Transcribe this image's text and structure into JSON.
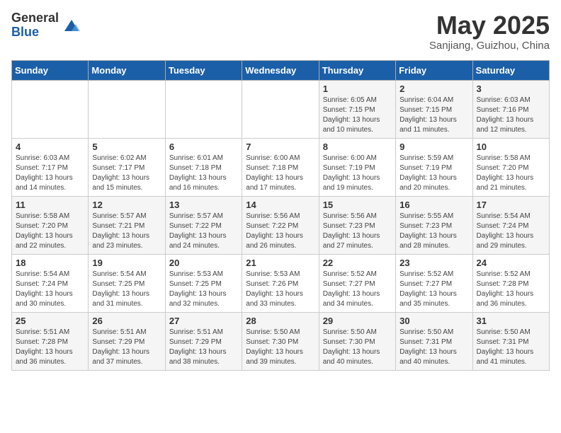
{
  "logo": {
    "general": "General",
    "blue": "Blue"
  },
  "title": "May 2025",
  "location": "Sanjiang, Guizhou, China",
  "days_of_week": [
    "Sunday",
    "Monday",
    "Tuesday",
    "Wednesday",
    "Thursday",
    "Friday",
    "Saturday"
  ],
  "weeks": [
    [
      {
        "day": "",
        "info": ""
      },
      {
        "day": "",
        "info": ""
      },
      {
        "day": "",
        "info": ""
      },
      {
        "day": "",
        "info": ""
      },
      {
        "day": "1",
        "info": "Sunrise: 6:05 AM\nSunset: 7:15 PM\nDaylight: 13 hours\nand 10 minutes."
      },
      {
        "day": "2",
        "info": "Sunrise: 6:04 AM\nSunset: 7:15 PM\nDaylight: 13 hours\nand 11 minutes."
      },
      {
        "day": "3",
        "info": "Sunrise: 6:03 AM\nSunset: 7:16 PM\nDaylight: 13 hours\nand 12 minutes."
      }
    ],
    [
      {
        "day": "4",
        "info": "Sunrise: 6:03 AM\nSunset: 7:17 PM\nDaylight: 13 hours\nand 14 minutes."
      },
      {
        "day": "5",
        "info": "Sunrise: 6:02 AM\nSunset: 7:17 PM\nDaylight: 13 hours\nand 15 minutes."
      },
      {
        "day": "6",
        "info": "Sunrise: 6:01 AM\nSunset: 7:18 PM\nDaylight: 13 hours\nand 16 minutes."
      },
      {
        "day": "7",
        "info": "Sunrise: 6:00 AM\nSunset: 7:18 PM\nDaylight: 13 hours\nand 17 minutes."
      },
      {
        "day": "8",
        "info": "Sunrise: 6:00 AM\nSunset: 7:19 PM\nDaylight: 13 hours\nand 19 minutes."
      },
      {
        "day": "9",
        "info": "Sunrise: 5:59 AM\nSunset: 7:19 PM\nDaylight: 13 hours\nand 20 minutes."
      },
      {
        "day": "10",
        "info": "Sunrise: 5:58 AM\nSunset: 7:20 PM\nDaylight: 13 hours\nand 21 minutes."
      }
    ],
    [
      {
        "day": "11",
        "info": "Sunrise: 5:58 AM\nSunset: 7:20 PM\nDaylight: 13 hours\nand 22 minutes."
      },
      {
        "day": "12",
        "info": "Sunrise: 5:57 AM\nSunset: 7:21 PM\nDaylight: 13 hours\nand 23 minutes."
      },
      {
        "day": "13",
        "info": "Sunrise: 5:57 AM\nSunset: 7:22 PM\nDaylight: 13 hours\nand 24 minutes."
      },
      {
        "day": "14",
        "info": "Sunrise: 5:56 AM\nSunset: 7:22 PM\nDaylight: 13 hours\nand 26 minutes."
      },
      {
        "day": "15",
        "info": "Sunrise: 5:56 AM\nSunset: 7:23 PM\nDaylight: 13 hours\nand 27 minutes."
      },
      {
        "day": "16",
        "info": "Sunrise: 5:55 AM\nSunset: 7:23 PM\nDaylight: 13 hours\nand 28 minutes."
      },
      {
        "day": "17",
        "info": "Sunrise: 5:54 AM\nSunset: 7:24 PM\nDaylight: 13 hours\nand 29 minutes."
      }
    ],
    [
      {
        "day": "18",
        "info": "Sunrise: 5:54 AM\nSunset: 7:24 PM\nDaylight: 13 hours\nand 30 minutes."
      },
      {
        "day": "19",
        "info": "Sunrise: 5:54 AM\nSunset: 7:25 PM\nDaylight: 13 hours\nand 31 minutes."
      },
      {
        "day": "20",
        "info": "Sunrise: 5:53 AM\nSunset: 7:25 PM\nDaylight: 13 hours\nand 32 minutes."
      },
      {
        "day": "21",
        "info": "Sunrise: 5:53 AM\nSunset: 7:26 PM\nDaylight: 13 hours\nand 33 minutes."
      },
      {
        "day": "22",
        "info": "Sunrise: 5:52 AM\nSunset: 7:27 PM\nDaylight: 13 hours\nand 34 minutes."
      },
      {
        "day": "23",
        "info": "Sunrise: 5:52 AM\nSunset: 7:27 PM\nDaylight: 13 hours\nand 35 minutes."
      },
      {
        "day": "24",
        "info": "Sunrise: 5:52 AM\nSunset: 7:28 PM\nDaylight: 13 hours\nand 36 minutes."
      }
    ],
    [
      {
        "day": "25",
        "info": "Sunrise: 5:51 AM\nSunset: 7:28 PM\nDaylight: 13 hours\nand 36 minutes."
      },
      {
        "day": "26",
        "info": "Sunrise: 5:51 AM\nSunset: 7:29 PM\nDaylight: 13 hours\nand 37 minutes."
      },
      {
        "day": "27",
        "info": "Sunrise: 5:51 AM\nSunset: 7:29 PM\nDaylight: 13 hours\nand 38 minutes."
      },
      {
        "day": "28",
        "info": "Sunrise: 5:50 AM\nSunset: 7:30 PM\nDaylight: 13 hours\nand 39 minutes."
      },
      {
        "day": "29",
        "info": "Sunrise: 5:50 AM\nSunset: 7:30 PM\nDaylight: 13 hours\nand 40 minutes."
      },
      {
        "day": "30",
        "info": "Sunrise: 5:50 AM\nSunset: 7:31 PM\nDaylight: 13 hours\nand 40 minutes."
      },
      {
        "day": "31",
        "info": "Sunrise: 5:50 AM\nSunset: 7:31 PM\nDaylight: 13 hours\nand 41 minutes."
      }
    ]
  ]
}
